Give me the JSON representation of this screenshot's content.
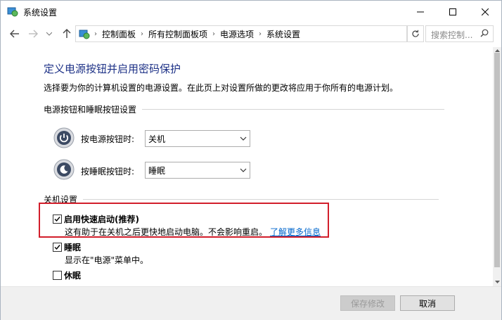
{
  "window": {
    "title": "系统设置"
  },
  "address": {
    "crumbs": [
      "控制面板",
      "所有控制面板项",
      "电源选项",
      "系统设置"
    ]
  },
  "search": {
    "placeholder": "搜索控制..."
  },
  "page": {
    "heading": "定义电源按钮并启用密码保护",
    "description": "选择要为你的计算机设置的电源设置。在此页上对设置所做的更改将应用于你所有的电源计划。"
  },
  "power_section": {
    "label": "电源按钮和睡眠按钮设置",
    "power_button": {
      "label": "按电源按钮时:",
      "value": "关机"
    },
    "sleep_button": {
      "label": "按睡眠按钮时:",
      "value": "睡眠"
    }
  },
  "shutdown_section": {
    "label": "关机设置",
    "fast_startup": {
      "label": "启用快速启动(推荐)",
      "checked": true,
      "description": "这有助于在关机之后更快地启动电脑。不会影响重启。",
      "link": "了解更多信息"
    },
    "sleep": {
      "label": "睡眠",
      "checked": true,
      "description": "显示在\"电源\"菜单中。"
    },
    "hibernate": {
      "label": "休眠",
      "checked": false
    }
  },
  "buttons": {
    "save": "保存修改",
    "cancel": "取消"
  },
  "colors": {
    "heading": "#1e3287",
    "link": "#0066cc",
    "highlight": "#d21e2b"
  }
}
